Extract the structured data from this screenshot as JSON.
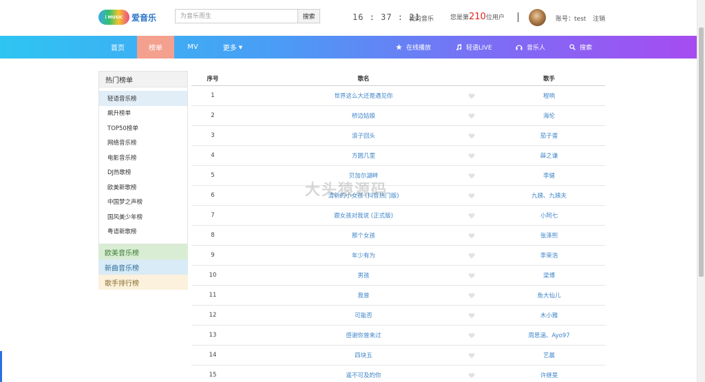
{
  "header": {
    "logo_badge": "i MUSIC",
    "logo_text": "爱音乐",
    "search_placeholder": "为音乐而生",
    "search_button": "搜索",
    "clock": "16 : 37 : 21",
    "my_music": "我的音乐",
    "user_rank_prefix": "您是第",
    "user_rank_number": "210",
    "user_rank_suffix": "位用户",
    "account": "账号：test",
    "logout": "注销"
  },
  "nav": {
    "home": "首页",
    "rank": "榜单",
    "mv": "MV",
    "more": "更多",
    "online_play": "在线播放",
    "light_live": "轻语LIVE",
    "musicians": "音乐人",
    "search": "搜索",
    "active_color": "#f4a08f"
  },
  "sidebar": {
    "head": "热门榜单",
    "items": [
      "轻语音乐榜",
      "飙升榜单",
      "TOP50榜单",
      "网络音乐榜",
      "电影音乐榜",
      "DJ热歌榜",
      "欧美新歌榜",
      "中国梦之声榜",
      "国风美少年榜",
      "粤语新歌榜"
    ],
    "categories": [
      "欧美音乐榜",
      "新曲音乐榜",
      "歌手排行榜"
    ]
  },
  "table": {
    "headers": {
      "num": "序号",
      "song": "歌名",
      "artist": "歌手"
    },
    "rows": [
      {
        "num": "1",
        "song": "世界这么大还是遇见你",
        "artist": "程响"
      },
      {
        "num": "2",
        "song": "桥边姑娘",
        "artist": "海伦"
      },
      {
        "num": "3",
        "song": "浪子回头",
        "artist": "茄子蛋"
      },
      {
        "num": "4",
        "song": "方圆几里",
        "artist": "薛之谦"
      },
      {
        "num": "5",
        "song": "贝加尔湖畔",
        "artist": "李健"
      },
      {
        "num": "6",
        "song": "清新的小女孩 (抖音热门版)",
        "artist": "九姨、九姨夫"
      },
      {
        "num": "7",
        "song": "跟女孩对我说 (正式版)",
        "artist": "小阿七"
      },
      {
        "num": "8",
        "song": "那个女孩",
        "artist": "张泽熙"
      },
      {
        "num": "9",
        "song": "年少有为",
        "artist": "李荣浩"
      },
      {
        "num": "10",
        "song": "男孩",
        "artist": "梁博"
      },
      {
        "num": "11",
        "song": "我曾",
        "artist": "鱼大仙儿"
      },
      {
        "num": "12",
        "song": "可能否",
        "artist": "木小雅"
      },
      {
        "num": "13",
        "song": "感谢你曾来过",
        "artist": "周思涵、Ayo97"
      },
      {
        "num": "14",
        "song": "四块五",
        "artist": "艺晨"
      },
      {
        "num": "15",
        "song": "遥不可及的你",
        "artist": "许继旻"
      }
    ]
  },
  "watermark": "大头猿源码"
}
